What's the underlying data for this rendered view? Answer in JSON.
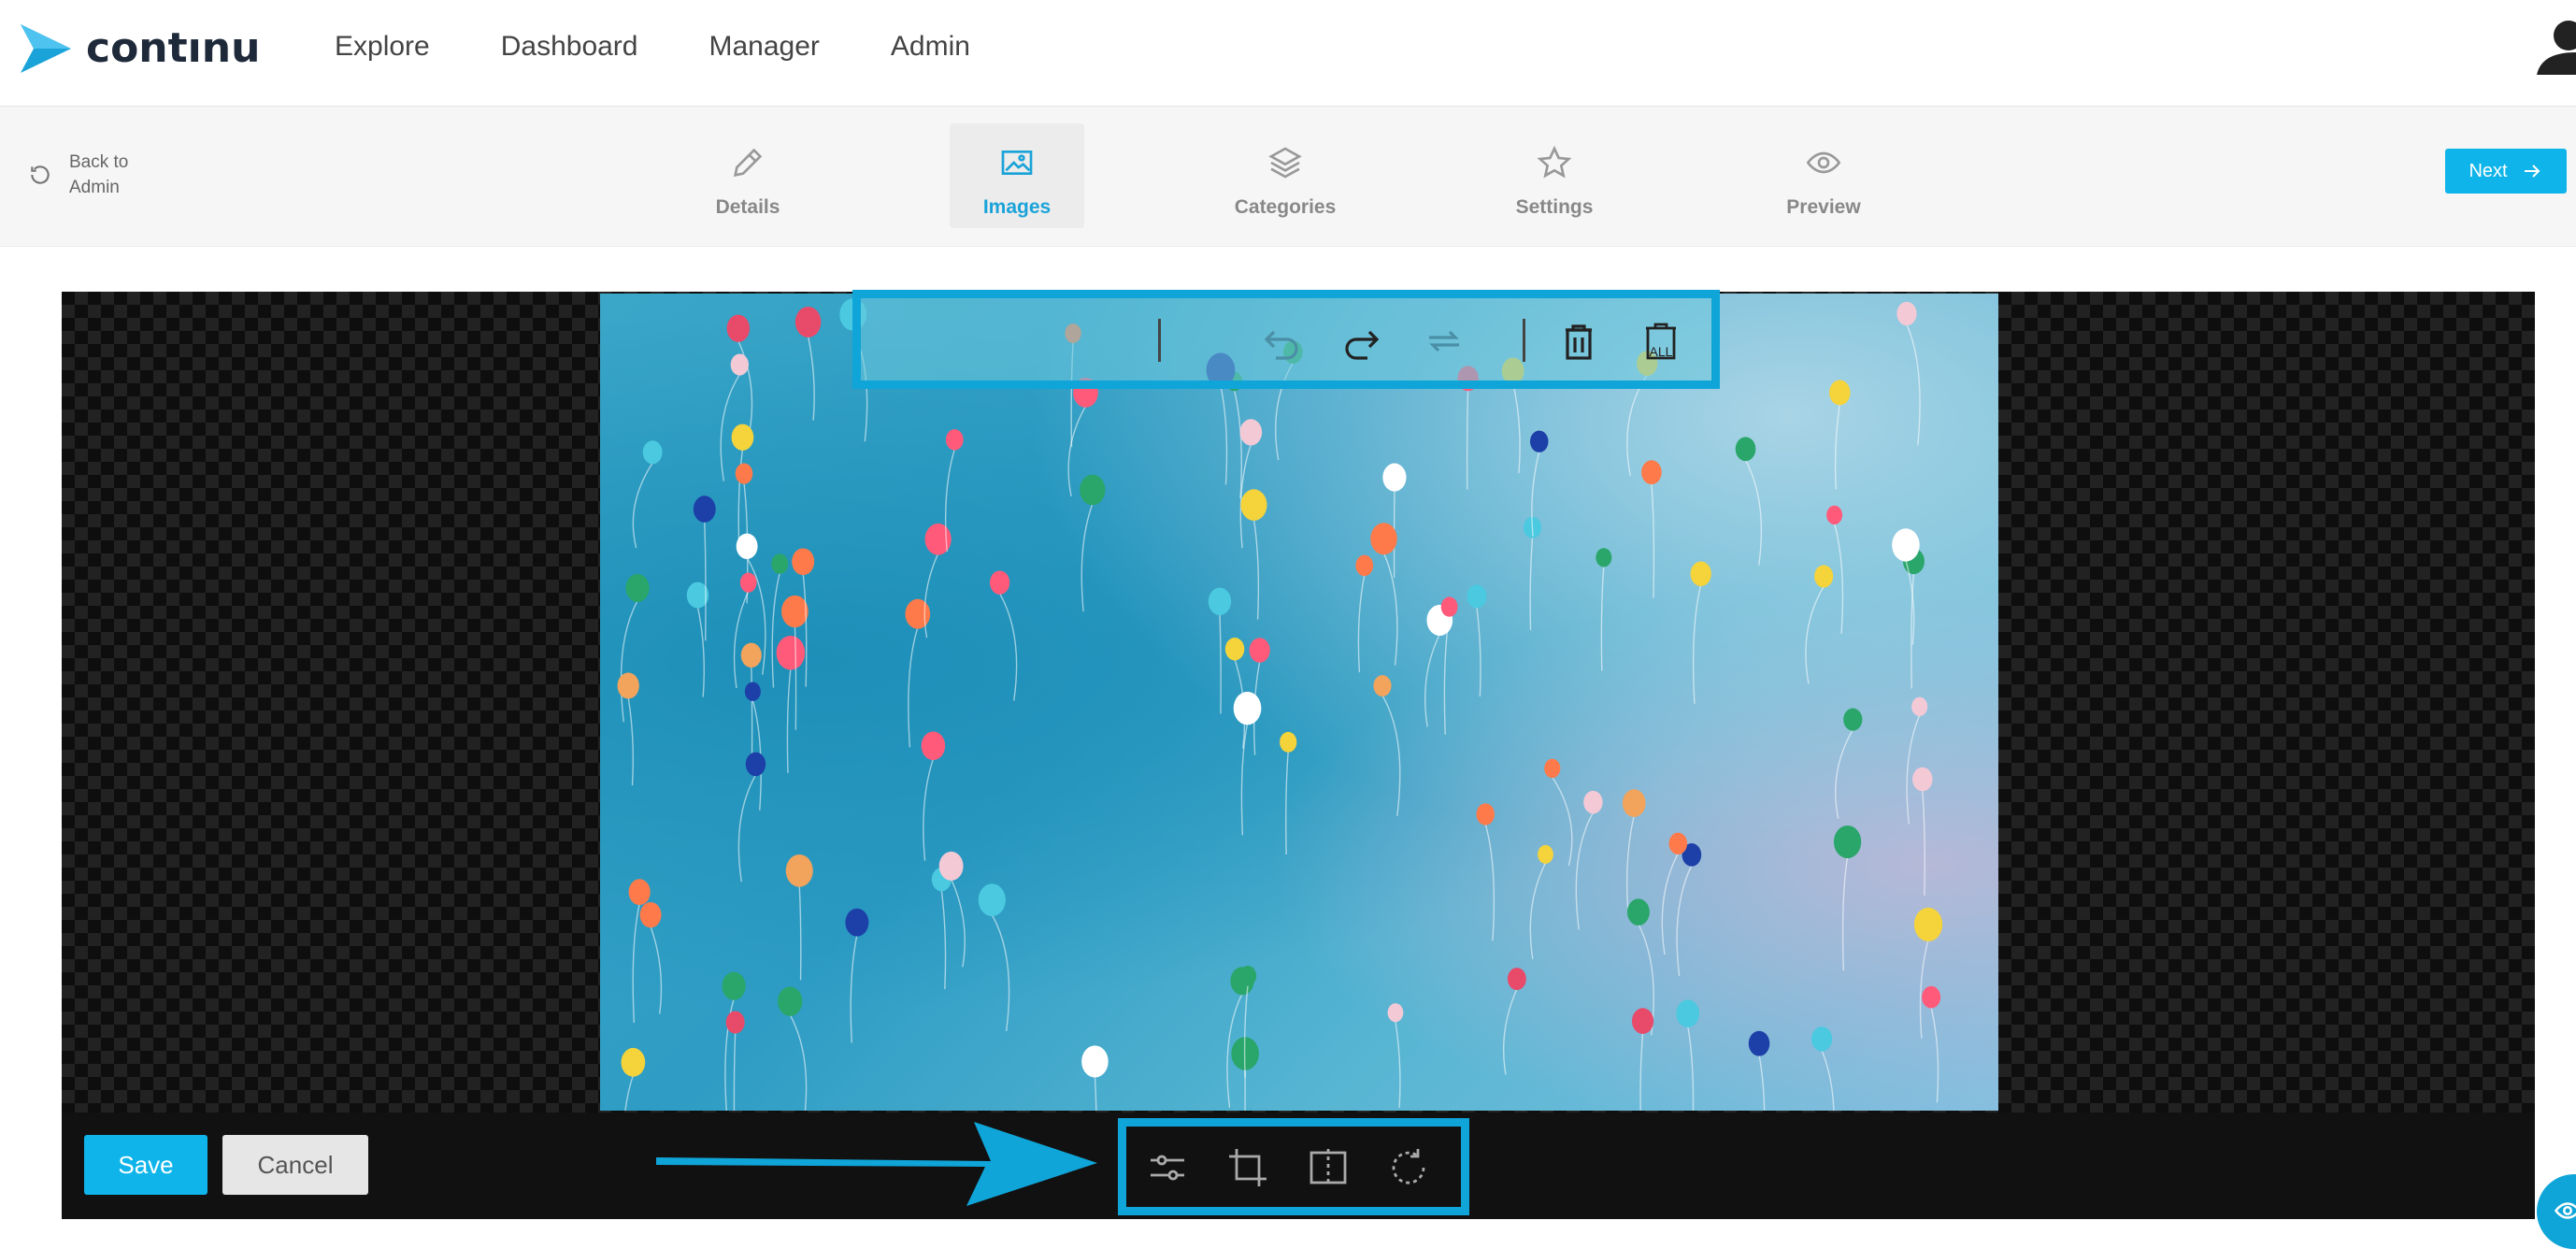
{
  "brand": {
    "name": "contınu",
    "color": "#1aa3d9"
  },
  "nav": {
    "items": [
      "Explore",
      "Dashboard",
      "Manager",
      "Admin"
    ]
  },
  "back": {
    "label": "Back to Admin"
  },
  "steps": [
    {
      "label": "Details",
      "icon": "pencil-icon",
      "active": false
    },
    {
      "label": "Images",
      "icon": "image-icon",
      "active": true
    },
    {
      "label": "Categories",
      "icon": "layers-icon",
      "active": false
    },
    {
      "label": "Settings",
      "icon": "star-icon",
      "active": false
    },
    {
      "label": "Preview",
      "icon": "eye-icon",
      "active": false
    }
  ],
  "next": {
    "label": "Next"
  },
  "image_toolbar": {
    "icons": [
      "undo-icon",
      "redo-icon",
      "reset-icon",
      "delete-icon",
      "delete-all-icon"
    ],
    "delete_all_text": "ALL"
  },
  "editor_tools": [
    "adjust-icon",
    "crop-icon",
    "flip-icon",
    "rotate-icon"
  ],
  "actions": {
    "save": "Save",
    "cancel": "Cancel"
  },
  "colors": {
    "accent": "#0fb5ea",
    "highlight": "#0fa5d8"
  }
}
